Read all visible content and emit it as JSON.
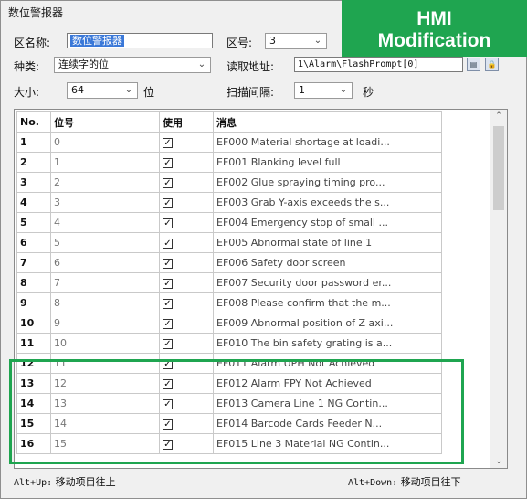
{
  "window": {
    "title": "数位警报器"
  },
  "banner": {
    "line1": "HMI",
    "line2": "Modification"
  },
  "form": {
    "name_label": "区名称:",
    "name_value": "数位警报器",
    "zone_label": "区号:",
    "zone_value": "3",
    "type_label": "种类:",
    "type_value": "连续字的位",
    "read_addr_label": "读取地址:",
    "read_addr_value": "1\\Alarm\\FlashPrompt[0]",
    "size_label": "大小:",
    "size_value": "64",
    "size_unit": "位",
    "scan_label": "扫描间隔:",
    "scan_value": "1",
    "scan_unit": "秒"
  },
  "table": {
    "headers": {
      "no": "No.",
      "bit": "位号",
      "use": "使用",
      "msg": "消息"
    },
    "rows": [
      {
        "no": "1",
        "bit": "0",
        "msg": "EF000 Material shortage at loadi..."
      },
      {
        "no": "2",
        "bit": "1",
        "msg": "EF001 Blanking level full"
      },
      {
        "no": "3",
        "bit": "2",
        "msg": "EF002 Glue spraying timing pro..."
      },
      {
        "no": "4",
        "bit": "3",
        "msg": "EF003 Grab Y-axis exceeds the s..."
      },
      {
        "no": "5",
        "bit": "4",
        "msg": "EF004 Emergency stop of small ..."
      },
      {
        "no": "6",
        "bit": "5",
        "msg": "EF005 Abnormal state of line 1"
      },
      {
        "no": "7",
        "bit": "6",
        "msg": "EF006 Safety door screen"
      },
      {
        "no": "8",
        "bit": "7",
        "msg": "EF007 Security door password er..."
      },
      {
        "no": "9",
        "bit": "8",
        "msg": "EF008 Please confirm that the m..."
      },
      {
        "no": "10",
        "bit": "9",
        "msg": "EF009 Abnormal position of Z axi..."
      },
      {
        "no": "11",
        "bit": "10",
        "msg": "EF010 The bin safety grating is a..."
      },
      {
        "no": "12",
        "bit": "11",
        "msg": "EF011 Alarm UPH Not Achieved"
      },
      {
        "no": "13",
        "bit": "12",
        "msg": "EF012 Alarm FPY Not Achieved"
      },
      {
        "no": "14",
        "bit": "13",
        "msg": "EF013 Camera Line 1 NG Contin..."
      },
      {
        "no": "15",
        "bit": "14",
        "msg": "EF014 Barcode Cards Feeder N..."
      },
      {
        "no": "16",
        "bit": "15",
        "msg": "EF015 Line 3 Material NG Contin..."
      }
    ],
    "check_glyph": "✓"
  },
  "footer": {
    "left_key": "Alt+Up:",
    "left_text": "移动项目往上",
    "right_key": "Alt+Down:",
    "right_text": "移动项目往下"
  },
  "colors": {
    "banner_green": "#1fa550",
    "selection_blue": "#3a78d8"
  }
}
